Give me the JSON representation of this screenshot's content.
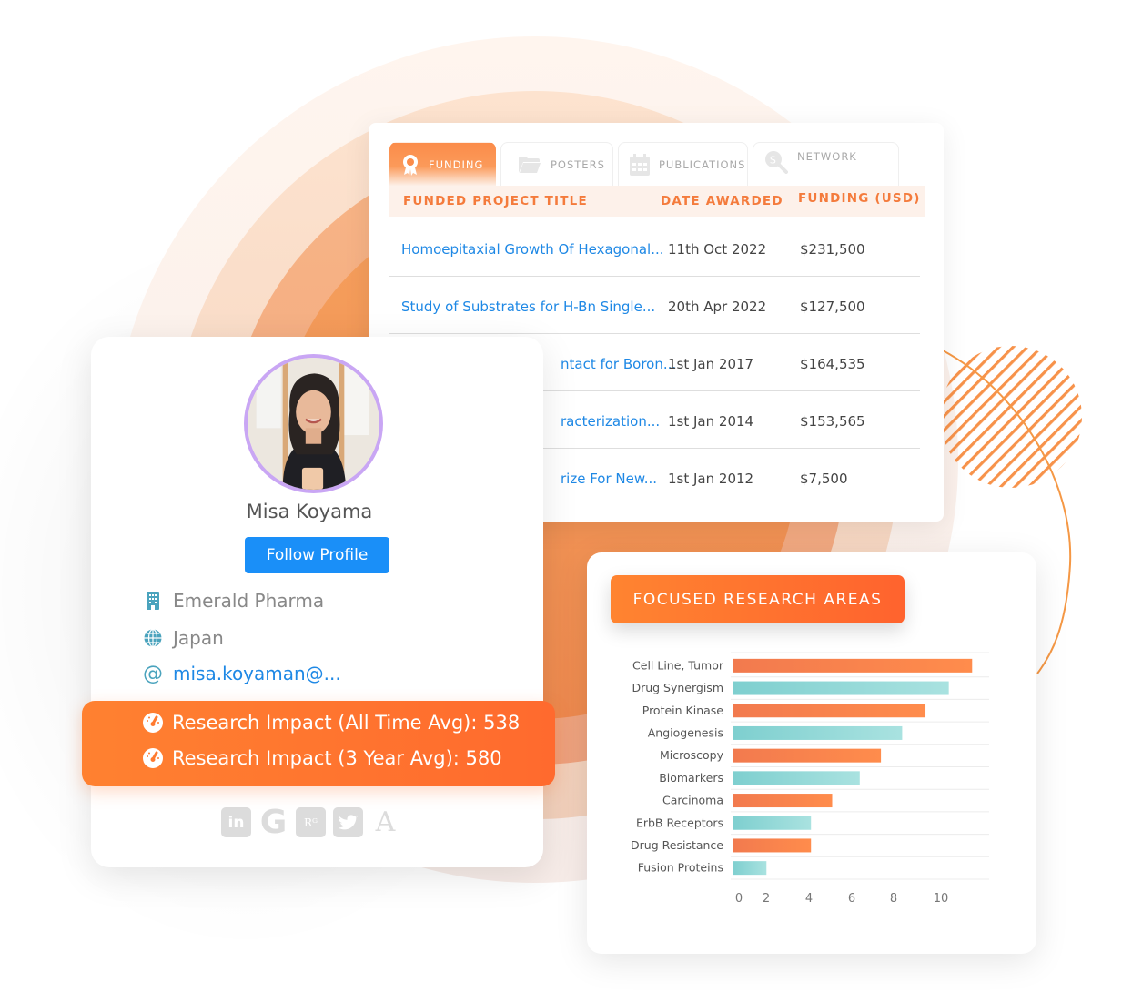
{
  "funding_table": {
    "tabs": [
      {
        "label": "FUNDING",
        "icon": "award-ribbon-icon",
        "active": true
      },
      {
        "label": "POSTERS",
        "icon": "folder-icon",
        "active": false
      },
      {
        "label": "PUBLICATIONS",
        "icon": "calendar-icon",
        "active": false
      },
      {
        "label": "NETWORK",
        "icon": "dollar-search-icon",
        "active": false
      }
    ],
    "columns": [
      "FUNDED PROJECT TITLE",
      "DATE AWARDED",
      "FUNDING (USD)"
    ],
    "rows": [
      {
        "title": "Homoepitaxial Growth Of Hexagonal...",
        "date": "11th Oct 2022",
        "amount": "$231,500"
      },
      {
        "title": "Study of Substrates for H-Bn Single...",
        "date": "20th Apr 2022",
        "amount": "$127,500"
      },
      {
        "title": "ntact for Boron...",
        "date": "1st Jan 2017",
        "amount": "$164,535"
      },
      {
        "title": "racterization...",
        "date": "1st Jan 2014",
        "amount": "$153,565"
      },
      {
        "title": "rize For New...",
        "date": "1st Jan 2012",
        "amount": "$7,500"
      }
    ]
  },
  "profile": {
    "name": "Misa Koyama",
    "follow_label": "Follow Profile",
    "organization": "Emerald Pharma",
    "country": "Japan",
    "email": "misa.koyaman@...",
    "impact": [
      {
        "label": "Research Impact (All Time Avg): 538"
      },
      {
        "label": "Research Impact (3 Year Avg): 580"
      }
    ],
    "socials": [
      {
        "name": "linkedin",
        "glyph": "in"
      },
      {
        "name": "google",
        "glyph": "G"
      },
      {
        "name": "researchgate",
        "glyph": "Rᴳ"
      },
      {
        "name": "twitter",
        "glyph": ""
      },
      {
        "name": "academia",
        "glyph": "A"
      }
    ]
  },
  "colors": {
    "accent_orange": "#ff7a30",
    "link_blue": "#1e88e5",
    "button_blue": "#1a8ff8",
    "teal": "#7ecfcf",
    "avatar_ring": "#c9a6f4"
  },
  "chart_data": {
    "type": "bar",
    "orientation": "horizontal",
    "title": "FOCUSED RESEARCH AREAS",
    "categories": [
      "Cell Line, Tumor",
      "Drug Synergism",
      "Protein Kinase",
      "Angiogenesis",
      "Microscopy",
      "Biomarkers",
      "Carcinoma",
      "ErbB Receptors",
      "Drug Resistance",
      "Fusion Proteins"
    ],
    "values": [
      11.3,
      10.2,
      9.1,
      8.0,
      7.0,
      6.0,
      4.7,
      3.7,
      3.7,
      1.6
    ],
    "bar_colors": [
      "orange",
      "teal",
      "orange",
      "teal",
      "orange",
      "teal",
      "orange",
      "teal",
      "orange",
      "teal"
    ],
    "xticks": [
      0,
      2,
      4,
      6,
      8,
      10
    ],
    "xlim": [
      0,
      12
    ],
    "xlabel": "",
    "ylabel": "",
    "grid": true,
    "legend": "none"
  }
}
